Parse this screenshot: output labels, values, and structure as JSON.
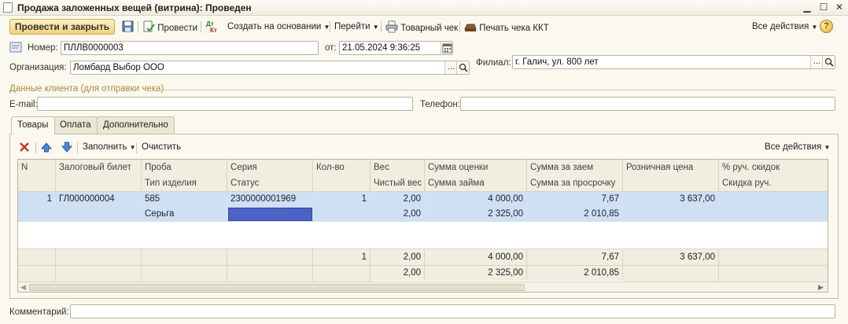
{
  "window": {
    "title": "Продажа заложенных вещей (витрина): Проведен",
    "min": "▁",
    "max": "☐",
    "close": "✕"
  },
  "toolbar": {
    "post_close": "Провести и закрыть",
    "post": "Провести",
    "create_based": "Создать на основании",
    "goto": "Перейти",
    "goods_check": "Товарный чек",
    "print_kkt": "Печать чека ККТ",
    "all_actions": "Все действия",
    "help": "?"
  },
  "header": {
    "number_label": "Номер:",
    "number_value": "ПЛЛВ0000003",
    "date_label": "от:",
    "date_value": "21.05.2024  9:36:25",
    "org_label": "Организация:",
    "org_value": "Ломбард Выбор ООО",
    "branch_label": "Филиал:",
    "branch_value": "г. Галич, ул. 800 лет",
    "dots": "...",
    "client_section": "Данные клиента (для отправки чека)",
    "email_label": "E-mail:",
    "email_value": "",
    "phone_label": "Телефон:",
    "phone_value": ""
  },
  "tabs": [
    {
      "label": "Товары"
    },
    {
      "label": "Оплата"
    },
    {
      "label": "Дополнительно"
    }
  ],
  "table_toolbar": {
    "fill": "Заполнить",
    "clear": "Очистить",
    "all_actions": "Все действия"
  },
  "table": {
    "headers_top": [
      "N",
      "Залоговый билет",
      "Проба",
      "Серия",
      "Кол-во",
      "Вес",
      "Сумма оценки",
      "Сумма за заем",
      "Розничная цена",
      "% руч. скидок"
    ],
    "headers_bottom": [
      "",
      "",
      "Тип изделия",
      "Статус",
      "",
      "Чистый вес",
      "Сумма займа",
      "Сумма за просрочку",
      "",
      "Скидка руч."
    ],
    "row": {
      "n": "1",
      "ticket": "ГЛ000000004",
      "probe": "585",
      "series": "2300000001969",
      "qty": "1",
      "weight": "2,00",
      "appraisal": "4 000,00",
      "loan_fee": "7,67",
      "retail": "3 637,00",
      "type": "Серьга",
      "status": "",
      "net_weight": "2,00",
      "loan_sum": "2 325,00",
      "overdue": "2 010,85"
    },
    "totals": {
      "qty": "1",
      "weight": "2,00",
      "appraisal": "4 000,00",
      "loan_fee": "7,67",
      "retail": "3 637,00",
      "net_weight": "2,00",
      "loan_sum": "2 325,00",
      "overdue": "2 010,85"
    }
  },
  "comment": {
    "label": "Комментарий:",
    "value": ""
  }
}
